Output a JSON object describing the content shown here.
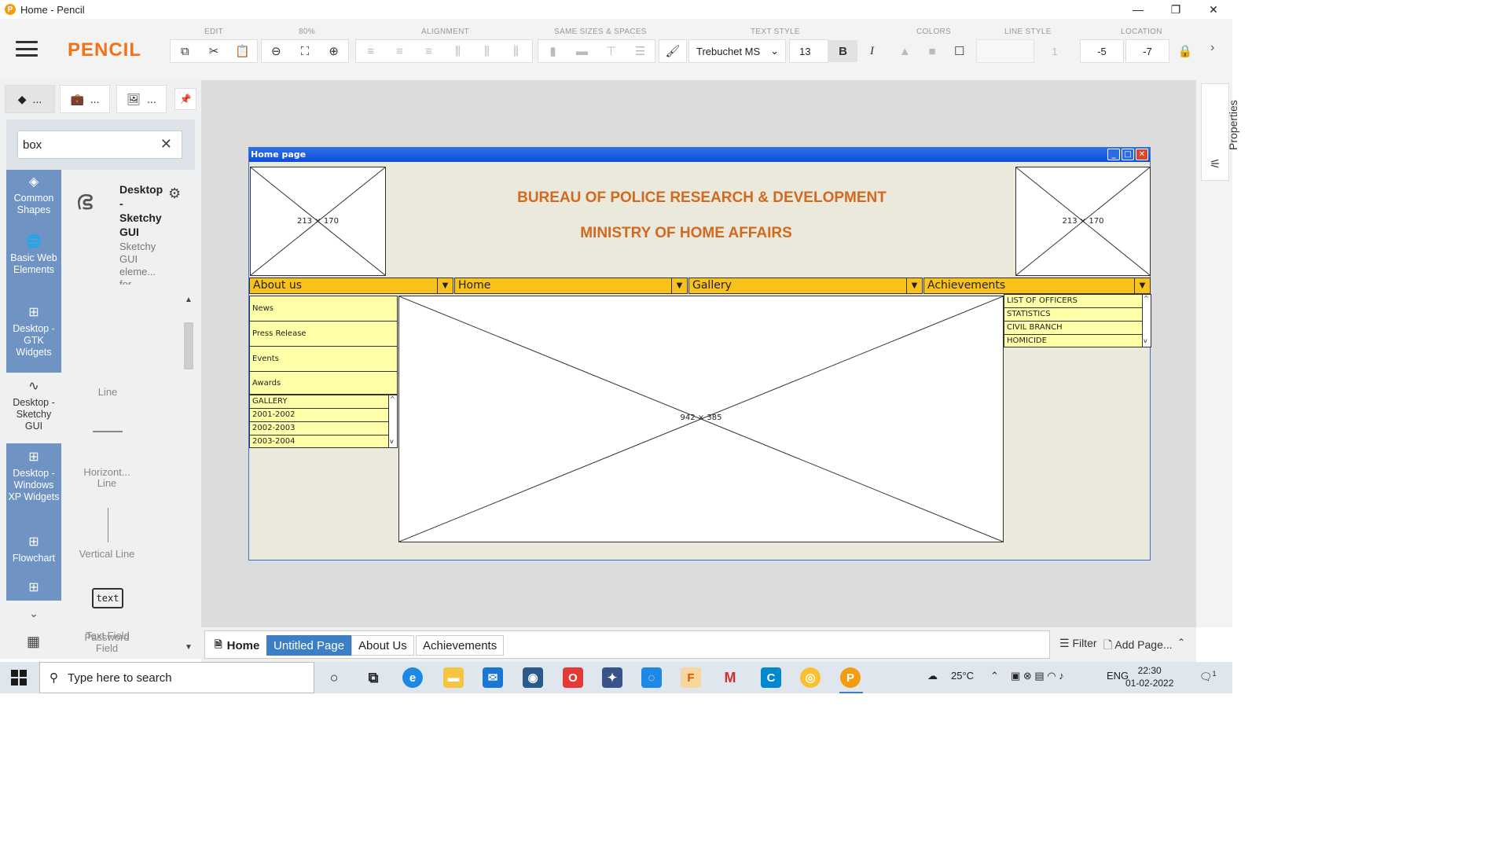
{
  "window": {
    "title": "Home - Pencil",
    "app_icon": "P",
    "controls": [
      "minimize-icon",
      "restore-icon",
      "close-icon"
    ]
  },
  "toolbar": {
    "brand": "PENCIL",
    "groups": {
      "edit": "EDIT",
      "zoom": "80%",
      "alignment": "ALIGNMENT",
      "same_sizes": "SAME SIZES & SPACES",
      "text_style": "TEXT STYLE",
      "colors": "COLORS",
      "line_style": "LINE STYLE",
      "location": "LOCATION"
    },
    "font_family": "Trebuchet MS",
    "font_size": "13",
    "line_width": "1",
    "location_x": "-5",
    "location_y": "-7",
    "accent_color": "#f0731a"
  },
  "left_panel": {
    "tabs": [
      "...",
      "...",
      "..."
    ],
    "search_value": "box",
    "categories": [
      {
        "label": "Common Shapes",
        "icon": "layers-icon"
      },
      {
        "label": "Basic Web Elements",
        "icon": "globe-icon"
      },
      {
        "label": "Desktop - GTK Widgets",
        "icon": "grid-icon"
      },
      {
        "label": "Desktop - Sketchy GUI",
        "icon": "squiggle-icon"
      },
      {
        "label": "Desktop - Windows XP Widgets",
        "icon": "grid-icon"
      },
      {
        "label": "Flowchart",
        "icon": "grid-icon"
      }
    ],
    "library": {
      "title": "Desktop - Sketchy GUI",
      "description": "Sketchy GUI eleme... for"
    },
    "shapes": [
      "Line",
      "Horizont... Line",
      "Vertical Line",
      "Text Field",
      "Password Field"
    ],
    "shape_glyphs": {
      "text_field": "text",
      "password_field": "***"
    }
  },
  "properties_panel": {
    "label": "Properties"
  },
  "wireframe": {
    "window_title": "Home page",
    "placeholder_left": "213 × 170",
    "placeholder_right": "213 × 170",
    "title_line1": "BUREAU OF POLICE RESEARCH & DEVELOPMENT",
    "title_line2": "MINISTRY OF HOME AFFAIRS",
    "nav": [
      "About us",
      "Home",
      "Gallery",
      "Achievements"
    ],
    "side_menu": [
      "News",
      "Press Release",
      "Events",
      "Awards"
    ],
    "gallery_list": [
      "GALLERY",
      "2001-2002",
      "2002-2003",
      "2003-2004"
    ],
    "main_placeholder": "942 × 385",
    "achievements_list": [
      "LIST OF OFFICERS",
      "STATISTICS",
      "CIVIL BRANCH",
      "HOMICIDE"
    ],
    "title_color": "#d2691e",
    "nav_color": "#f9c21b",
    "menu_color": "#ffffa8"
  },
  "pages": {
    "home": "Home",
    "tabs": [
      "Untitled Page",
      "About Us",
      "Achievements"
    ],
    "active": "Untitled Page",
    "filter": "Filter",
    "add_page": "Add Page..."
  },
  "taskbar": {
    "search_placeholder": "Type here to search",
    "weather": "25°C",
    "lang": "ENG",
    "time": "22:30",
    "date": "01-02-2022",
    "notification_count": "1"
  }
}
